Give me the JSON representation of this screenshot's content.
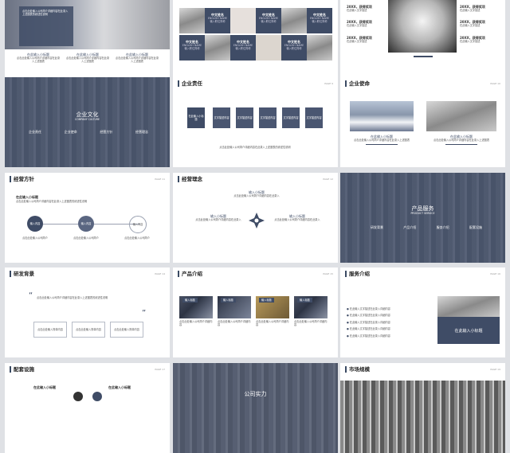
{
  "slides": {
    "s1": {
      "body": "点击此处输入公司简介详细内容在此录入上述图表的综述性说明",
      "items": [
        {
          "title": "在此输入小标题",
          "text": "点击此处输入公司简介详细内容在此录入上述图表"
        },
        {
          "title": "在此输入小标题",
          "text": "点击此处输入公司简介详细内容在此录入上述图表"
        },
        {
          "title": "在此输入小标题",
          "text": "点击此处输入公司简介详细内容在此录入上述图表"
        }
      ]
    },
    "s2": {
      "cells": [
        {
          "name": "中文姓名",
          "en": "ENGLISH NAME",
          "desc": "输入职位简称"
        },
        {
          "name": "中文姓名",
          "en": "ENGLISH NAME",
          "desc": "输入职位简称"
        },
        {
          "name": "中文姓名",
          "en": "ENGLISH NAME",
          "desc": "输入职位简称"
        },
        {
          "name": "中文姓名",
          "en": "ENGLISH NAME",
          "desc": "输入职位简称"
        },
        {
          "name": "中文姓名",
          "en": "ENGLISH NAME",
          "desc": "输入职位简称"
        },
        {
          "name": "中文姓名",
          "en": "ENGLISH NAME",
          "desc": "输入职位简称"
        }
      ]
    },
    "s3": {
      "awards": [
        {
          "year": "20XX，获得奖项",
          "text": "在此输入文字描述"
        },
        {
          "year": "20XX，获得奖项",
          "text": "在此输入文字描述"
        },
        {
          "year": "20XX，获得奖项",
          "text": "在此输入文字描述"
        },
        {
          "year": "20XX，获得奖项",
          "text": "在此输入文字描述"
        },
        {
          "year": "20XX，获得奖项",
          "text": "在此输入文字描述"
        },
        {
          "year": "20XX，获得奖项",
          "text": "在此输入文字描述"
        }
      ]
    },
    "s4": {
      "title": "企业文化",
      "subtitle": "COMPANY CULTURE",
      "items": [
        "企业责任",
        "企业使命",
        "经营方针",
        "经营理念"
      ]
    },
    "s5": {
      "title": "企业责任",
      "page": "PAGE 9",
      "boxes": [
        "在此输入小标题",
        "文字描述内容",
        "文字描述内容",
        "文字描述内容",
        "文字描述内容",
        "文字描述内容"
      ],
      "foot": "点击此处输入公司简介详细内容在此录入上述图表的综述性说明"
    },
    "s6": {
      "title": "企业使命",
      "page": "PAGE 10",
      "items": [
        {
          "title": "在此输入小标题",
          "text": "点击此处输入公司简介详细内容在此录入上述图表"
        },
        {
          "title": "在此输入小标题",
          "text": "点击此处输入公司简介详细内容在此录入上述图表"
        }
      ]
    },
    "s7": {
      "title": "经营方针",
      "page": "PAGE 11",
      "lead": "在此输入小标题",
      "desc": "点击此处输入公司简介详细内容在此录入上述图表的综述性说明",
      "circles": [
        "输入内容",
        "输入内容",
        "输入内容"
      ],
      "captions": [
        "点击此处输入公司简介",
        "点击此处输入公司简介",
        "点击此处输入公司简介"
      ]
    },
    "s8": {
      "title": "经营理念",
      "page": "PAGE 12",
      "labels": [
        "输入小标题",
        "输入小标题",
        "输入小标题"
      ],
      "texts": [
        "点击此处输入公司简介详细内容在此录入",
        "点击此处输入公司简介详细内容在此录入",
        "点击此处输入公司简介详细内容在此录入"
      ]
    },
    "s9": {
      "title": "产品服务",
      "subtitle": "PRODUCT SERVICE",
      "items": [
        "研发背景",
        "产品介绍",
        "服务介绍",
        "配套设施"
      ]
    },
    "s10": {
      "title": "研发背景",
      "page": "PAGE 14",
      "quote": "点击此处输入公司简介详细内容在此录入上述图表的综述性说明",
      "boxes": [
        "点击此处输入简单内容",
        "点击此处输入简单内容",
        "点击此处输入简单内容"
      ]
    },
    "s11": {
      "title": "产品介绍",
      "page": "PAGE 15",
      "items": [
        {
          "label": "输入标题",
          "text": "点击此处输入公司简介详细内容"
        },
        {
          "label": "输入标题",
          "text": "点击此处输入公司简介详细内容"
        },
        {
          "label": "输入标题",
          "text": "点击此处输入公司简介详细内容"
        },
        {
          "label": "输入标题",
          "text": "点击此处输入公司简介详细内容"
        }
      ]
    },
    "s12": {
      "title": "服务介绍",
      "page": "PAGE 16",
      "bullets": [
        "在此输入文字描述在此录入详细内容",
        "在此输入文字描述在此录入详细内容",
        "在此输入文字描述在此录入详细内容",
        "在此输入文字描述在此录入详细内容",
        "在此输入文字描述在此录入详细内容"
      ],
      "box": "在此输入小标题"
    },
    "s13": {
      "title": "配套设施",
      "page": "PAGE 17",
      "items": [
        "在此输入小标题",
        "在此输入小标题"
      ]
    },
    "s14": {
      "title": "公司实力"
    },
    "s15": {
      "title": "市场规模",
      "page": "PAGE 19"
    }
  }
}
